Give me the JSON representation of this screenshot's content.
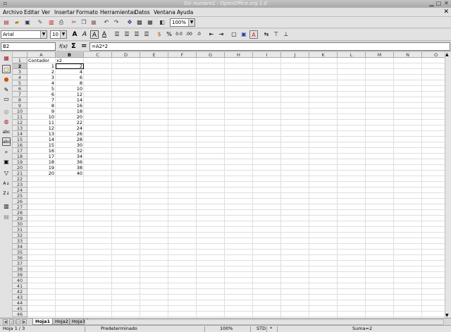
{
  "window": {
    "title": "Sin nombre1 - OpenOffice.org 1.0"
  },
  "menu": [
    "Archivo",
    "Editar",
    "Ver",
    "Insertar",
    "Formato",
    "Herramientas",
    "Datos",
    "Ventana",
    "Ayuda"
  ],
  "toolbar": {
    "zoom": "100%",
    "font_name": "Arial",
    "font_size": "10"
  },
  "formula": {
    "cell_ref": "B2",
    "fx_label": "f(x)",
    "sum_label": "Σ",
    "eq_label": "=",
    "content": "=A2*2"
  },
  "sheet": {
    "columns": [
      "A",
      "B",
      "C",
      "D",
      "E",
      "F",
      "G",
      "H",
      "I",
      "J",
      "K",
      "L",
      "M",
      "N",
      "O"
    ],
    "selected_column": "B",
    "selected_row": 2,
    "header_row": [
      "Contador",
      "x2"
    ],
    "a_values": [
      1,
      2,
      3,
      4,
      5,
      6,
      7,
      8,
      9,
      10,
      11,
      12,
      13,
      14,
      15,
      16,
      17,
      18,
      19,
      20
    ],
    "b_values": [
      2,
      4,
      6,
      8,
      10,
      12,
      14,
      16,
      18,
      20,
      22,
      24,
      26,
      28,
      30,
      32,
      34,
      36,
      38,
      40
    ],
    "row_count": 47
  },
  "tabs": [
    "Hoja1",
    "Hoja2",
    "Hoja3"
  ],
  "active_tab": "Hoja1",
  "status": {
    "sheet": "Hoja 1 / 3",
    "style": "Predeterminado",
    "zoom": "100%",
    "mode": "STD",
    "modified": "*",
    "sum": "Suma=2"
  }
}
